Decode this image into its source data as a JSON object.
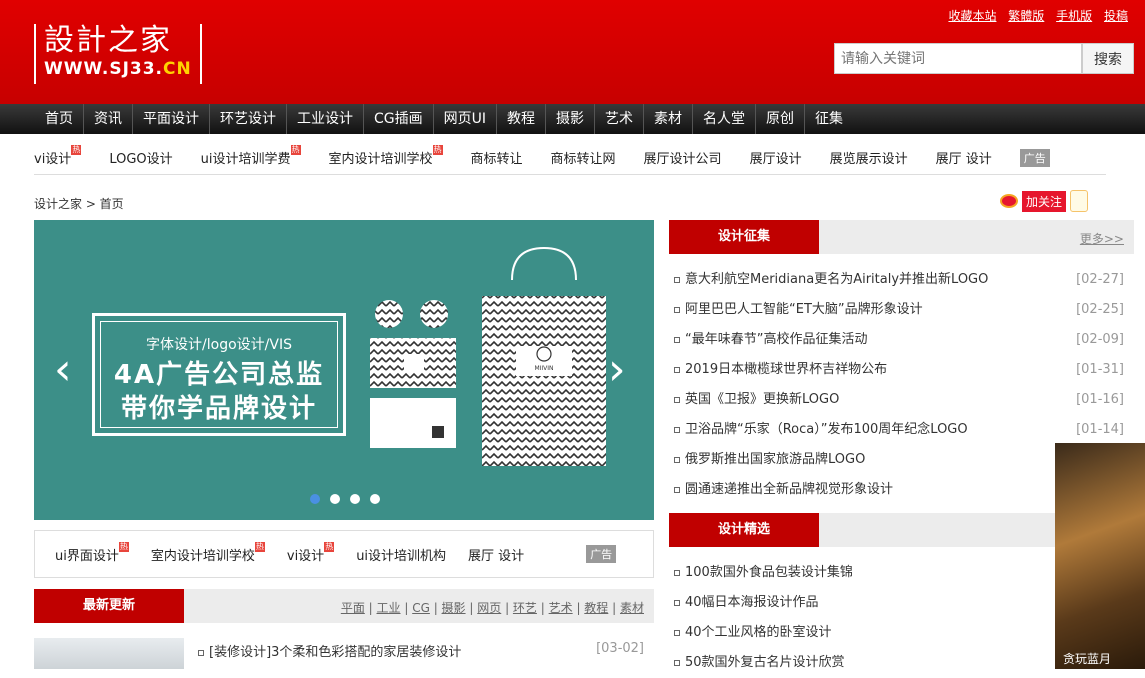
{
  "header": {
    "logo_cn": "設計之家",
    "logo_en_prefix": "WWW.SJ33.",
    "logo_en_suffix": "CN",
    "top_links": [
      "收藏本站",
      "繁體版",
      "手机版",
      "投稿"
    ],
    "search_placeholder": "请输入关键词",
    "search_button": "搜索"
  },
  "nav": [
    "首页",
    "资讯",
    "平面设计",
    "环艺设计",
    "工业设计",
    "CG插画",
    "网页UI",
    "教程",
    "摄影",
    "艺术",
    "素材",
    "名人堂",
    "原创",
    "征集"
  ],
  "hotbar": {
    "items": [
      {
        "label": "vi设计",
        "hot": true
      },
      {
        "label": "LOGO设计",
        "hot": false
      },
      {
        "label": "ui设计培训学费",
        "hot": true
      },
      {
        "label": "室内设计培训学校",
        "hot": true
      },
      {
        "label": "商标转让",
        "hot": false
      },
      {
        "label": "商标转让网",
        "hot": false
      },
      {
        "label": "展厅设计公司",
        "hot": false
      },
      {
        "label": "展厅设计",
        "hot": false
      },
      {
        "label": "展览展示设计",
        "hot": false
      },
      {
        "label": "展厅 设计",
        "hot": false
      }
    ],
    "hot_tag": "热",
    "ad_label": "广告"
  },
  "breadcrumb": "设计之家 > 首页",
  "weibo_follow": "加关注",
  "banner": {
    "subtitle": "字体设计/logo设计/VIS",
    "line1": "4A广告公司总监",
    "line2": "带你学品牌设计",
    "bag_brand": "MIIVIN",
    "slides": 4,
    "active_slide": 0
  },
  "adbar2": {
    "items": [
      {
        "label": "ui界面设计",
        "hot": true
      },
      {
        "label": "室内设计培训学校",
        "hot": true
      },
      {
        "label": "vi设计",
        "hot": true
      },
      {
        "label": "ui设计培训机构",
        "hot": false
      },
      {
        "label": "展厅 设计",
        "hot": false
      }
    ],
    "ad_label": "广告"
  },
  "latest": {
    "title": "最新更新",
    "categories": [
      "平面",
      "工业",
      "CG",
      "摄影",
      "网页",
      "环艺",
      "艺术",
      "教程",
      "素材"
    ],
    "items": [
      {
        "title": "[装修设计]3个柔和色彩搭配的家居装修设计",
        "date": "[03-02]"
      }
    ]
  },
  "solicit": {
    "title": "设计征集",
    "more": "更多>>",
    "items": [
      {
        "title": "意大利航空Meridiana更名为Airitaly并推出新LOGO",
        "date": "[02-27]"
      },
      {
        "title": "阿里巴巴人工智能“ET大脑”品牌形象设计",
        "date": "[02-25]"
      },
      {
        "title": "“最年味春节”高校作品征集活动",
        "date": "[02-09]"
      },
      {
        "title": "2019日本橄榄球世界杯吉祥物公布",
        "date": "[01-31]"
      },
      {
        "title": "英国《卫报》更换新LOGO",
        "date": "[01-16]"
      },
      {
        "title": "卫浴品牌“乐家（Roca）”发布100周年纪念LOGO",
        "date": "[01-14]"
      },
      {
        "title": "俄罗斯推出国家旅游品牌LOGO",
        "date": ""
      },
      {
        "title": "圆通速递推出全新品牌视觉形象设计",
        "date": ""
      }
    ]
  },
  "featured": {
    "title": "设计精选",
    "items": [
      {
        "title": "100款国外食品包装设计集锦"
      },
      {
        "title": "40幅日本海报设计作品"
      },
      {
        "title": "40个工业风格的卧室设计"
      },
      {
        "title": "50款国外复古名片设计欣赏"
      }
    ]
  },
  "side_ad_text": "贪玩蓝月",
  "colors": {
    "brand_red": "#c00000",
    "nav_dark": "#1a1a1a",
    "banner_teal": "#3c8f88"
  }
}
